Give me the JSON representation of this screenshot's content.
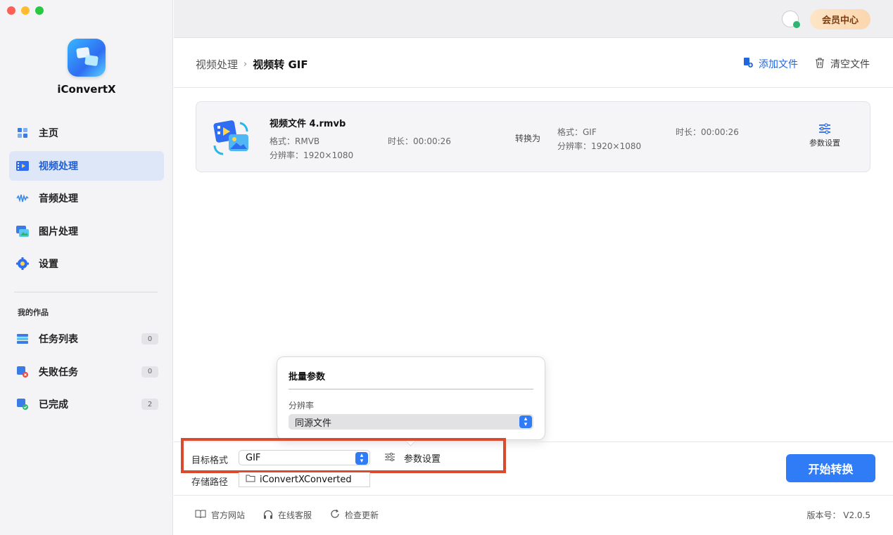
{
  "app": {
    "name": "iConvertX",
    "colors": {
      "accent": "#2f7cf6",
      "active_nav_bg": "#dde7f7",
      "highlight": "#d94a2f"
    }
  },
  "sidebar": {
    "nav": [
      {
        "label": "主页",
        "icon": "home-icon"
      },
      {
        "label": "视频处理",
        "icon": "video-icon",
        "active": true
      },
      {
        "label": "音频处理",
        "icon": "audio-wave-icon"
      },
      {
        "label": "图片处理",
        "icon": "image-icon"
      },
      {
        "label": "设置",
        "icon": "gear-icon"
      }
    ],
    "section_title": "我的作品",
    "works": [
      {
        "label": "任务列表",
        "count": "0",
        "icon": "task-list-icon"
      },
      {
        "label": "失败任务",
        "count": "0",
        "icon": "failed-task-icon"
      },
      {
        "label": "已完成",
        "count": "2",
        "icon": "completed-icon"
      }
    ]
  },
  "topbar": {
    "vip_label": "会员中心"
  },
  "header": {
    "breadcrumb_parent": "视频处理",
    "breadcrumb_sep": "›",
    "breadcrumb_current": "视频转 GIF",
    "add_file": "添加文件",
    "clear_files": "清空文件"
  },
  "file": {
    "name": "视频文件 4.rmvb",
    "src_format": "格式：RMVB",
    "src_resolution": "分辨率：1920×1080",
    "src_duration": "时长：00:00:26",
    "convert_to": "转换为",
    "dst_format": "格式：GIF",
    "dst_resolution": "分辨率：1920×1080",
    "dst_duration": "时长：00:00:26",
    "params_label": "参数设置"
  },
  "popover": {
    "title": "批量参数",
    "resolution_label": "分辨率",
    "resolution_value": "同源文件"
  },
  "bottom": {
    "target_format_label": "目标格式",
    "target_format_value": "GIF",
    "params_label": "参数设置",
    "save_path_label": "存储路径",
    "save_path_value": "iConvertXConverted",
    "start_label": "开始转换"
  },
  "footer": {
    "website": "官方网站",
    "support": "在线客服",
    "update": "检查更新",
    "version": "版本号：  V2.0.5"
  }
}
